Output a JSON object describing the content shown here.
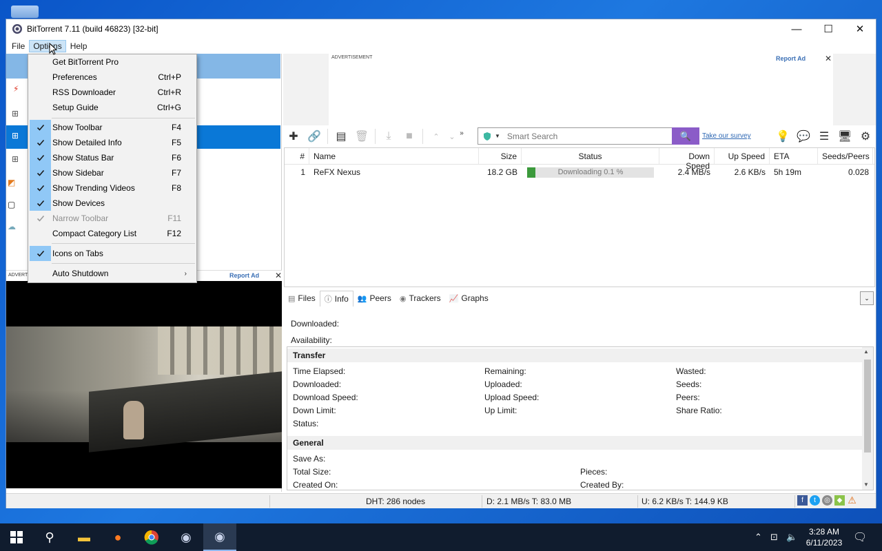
{
  "window": {
    "title": "BitTorrent 7.11  (build 46823) [32-bit]",
    "controls": {
      "minimize": "—",
      "maximize": "☐",
      "close": "✕"
    }
  },
  "menubar": {
    "file": "File",
    "options": "Options",
    "help": "Help"
  },
  "options_menu": {
    "items": [
      {
        "label": "Get BitTorrent Pro",
        "shortcut": ""
      },
      {
        "label": "Preferences",
        "shortcut": "Ctrl+P"
      },
      {
        "label": "RSS Downloader",
        "shortcut": "Ctrl+R"
      },
      {
        "label": "Setup Guide",
        "shortcut": "Ctrl+G"
      },
      {
        "label": "Show Toolbar",
        "shortcut": "F4",
        "checked": true
      },
      {
        "label": "Show Detailed Info",
        "shortcut": "F5",
        "checked": true
      },
      {
        "label": "Show Status Bar",
        "shortcut": "F6",
        "checked": true
      },
      {
        "label": "Show Sidebar",
        "shortcut": "F7",
        "checked": true
      },
      {
        "label": "Show Trending Videos",
        "shortcut": "F8",
        "checked": true
      },
      {
        "label": "Show Devices",
        "shortcut": "",
        "checked": true
      },
      {
        "label": "Narrow Toolbar",
        "shortcut": "F11",
        "checked": true,
        "disabled": true
      },
      {
        "label": "Compact Category List",
        "shortcut": "F12"
      },
      {
        "label": "Icons on Tabs",
        "shortcut": "",
        "checked": true
      },
      {
        "label": "Auto Shutdown",
        "shortcut": "",
        "submenu": "›"
      }
    ]
  },
  "ads": {
    "top": {
      "label": "ADVERTISEMENT",
      "report": "Report Ad",
      "close": "✕"
    },
    "left": {
      "label": "ADVERTI",
      "report": "Report Ad",
      "close": "✕"
    }
  },
  "search": {
    "placeholder": "Smart Search",
    "survey": "Take our survey"
  },
  "torrents": {
    "headers": [
      "#",
      "Name",
      "Size",
      "Status",
      "Down Speed",
      "Up Speed",
      "ETA",
      "Seeds/Peers"
    ],
    "rows": [
      {
        "num": "1",
        "name": "ReFX Nexus",
        "size": "18.2 GB",
        "status": "Downloading 0.1 %",
        "progress": 0.001,
        "down": "2.4 MB/s",
        "up": "2.6 KB/s",
        "eta": "5h 19m",
        "seeds": "0.028"
      }
    ]
  },
  "tabs": {
    "files": "Files",
    "info": "Info",
    "peers": "Peers",
    "trackers": "Trackers",
    "graphs": "Graphs"
  },
  "downloaded": {
    "downloaded": "Downloaded:",
    "availability": "Availability:"
  },
  "transfer": {
    "title": "Transfer",
    "time_elapsed": "Time Elapsed:",
    "downloaded": "Downloaded:",
    "download_speed": "Download Speed:",
    "down_limit": "Down Limit:",
    "status": "Status:",
    "remaining": "Remaining:",
    "uploaded": "Uploaded:",
    "upload_speed": "Upload Speed:",
    "up_limit": "Up Limit:",
    "wasted": "Wasted:",
    "seeds": "Seeds:",
    "peers": "Peers:",
    "share_ratio": "Share Ratio:"
  },
  "general": {
    "title": "General",
    "save_as": "Save As:",
    "total_size": "Total Size:",
    "created_on": "Created On:",
    "pieces": "Pieces:",
    "created_by": "Created By:"
  },
  "statusbar": {
    "dht": "DHT: 286 nodes",
    "down": "D: 2.1 MB/s T: 83.0 MB",
    "up": "U: 6.2 KB/s T: 144.9 KB"
  },
  "clock": {
    "time": "3:28 AM",
    "date": "6/11/2023"
  },
  "colors": {
    "accent": "#0a78d7",
    "search_button": "#8b5cc8",
    "check_highlight": "#90c8f6",
    "taskbar": "#101c2e"
  }
}
